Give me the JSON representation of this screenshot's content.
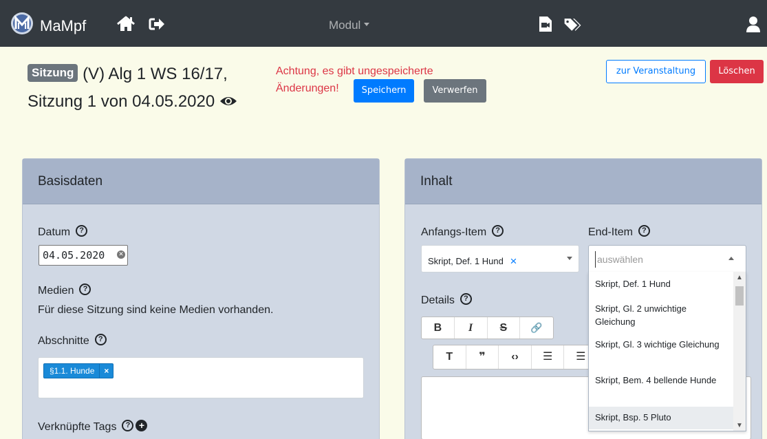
{
  "navbar": {
    "brand": "MaMpf",
    "modul_label": "Modul"
  },
  "header": {
    "badge": "Sitzung",
    "title_text": "(V) Alg 1 WS 16/17, Sitzung 1 von 04.05.2020",
    "warning": "Achtung, es gibt ungespeicherte Änderungen!",
    "save_label": "Speichern",
    "discard_label": "Verwerfen",
    "course_label": "zur Veranstaltung",
    "delete_label": "Löschen"
  },
  "basis": {
    "title": "Basisdaten",
    "date_label": "Datum",
    "date_value": "04.05.2020",
    "media_label": "Medien",
    "media_text": "Für diese Sitzung sind keine Medien vorhanden.",
    "sections_label": "Abschnitte",
    "section_chip": "§1.1. Hunde",
    "chip_remove": "×",
    "tags_label": "Verknüpfte Tags"
  },
  "content": {
    "title": "Inhalt",
    "start_label": "Anfangs-Item",
    "start_value": "Skript, Def. 1 Hund",
    "start_clear": "×",
    "end_label": "End-Item",
    "end_placeholder": "auswählen",
    "details_label": "Details",
    "toolbar1": [
      "B",
      "I",
      "S",
      "🔗"
    ],
    "toolbar2": [
      "T",
      "❞",
      "‹›",
      "☰",
      "☰"
    ],
    "options": [
      "Skript, Def. 1 Hund",
      "Skript, Gl. 2 unwichtige Gleichung",
      "Skript, Gl. 3 wichtige Gleichung",
      "Skript, Bem. 4 bellende Hunde",
      "Skript, Bsp. 5 Pluto"
    ]
  },
  "colors": {
    "navbar": "#343a40",
    "primary": "#007bff",
    "danger": "#dc3545",
    "secondary": "#6c757d",
    "card": "#d0d8e4",
    "card_header": "#a6b3c9"
  }
}
